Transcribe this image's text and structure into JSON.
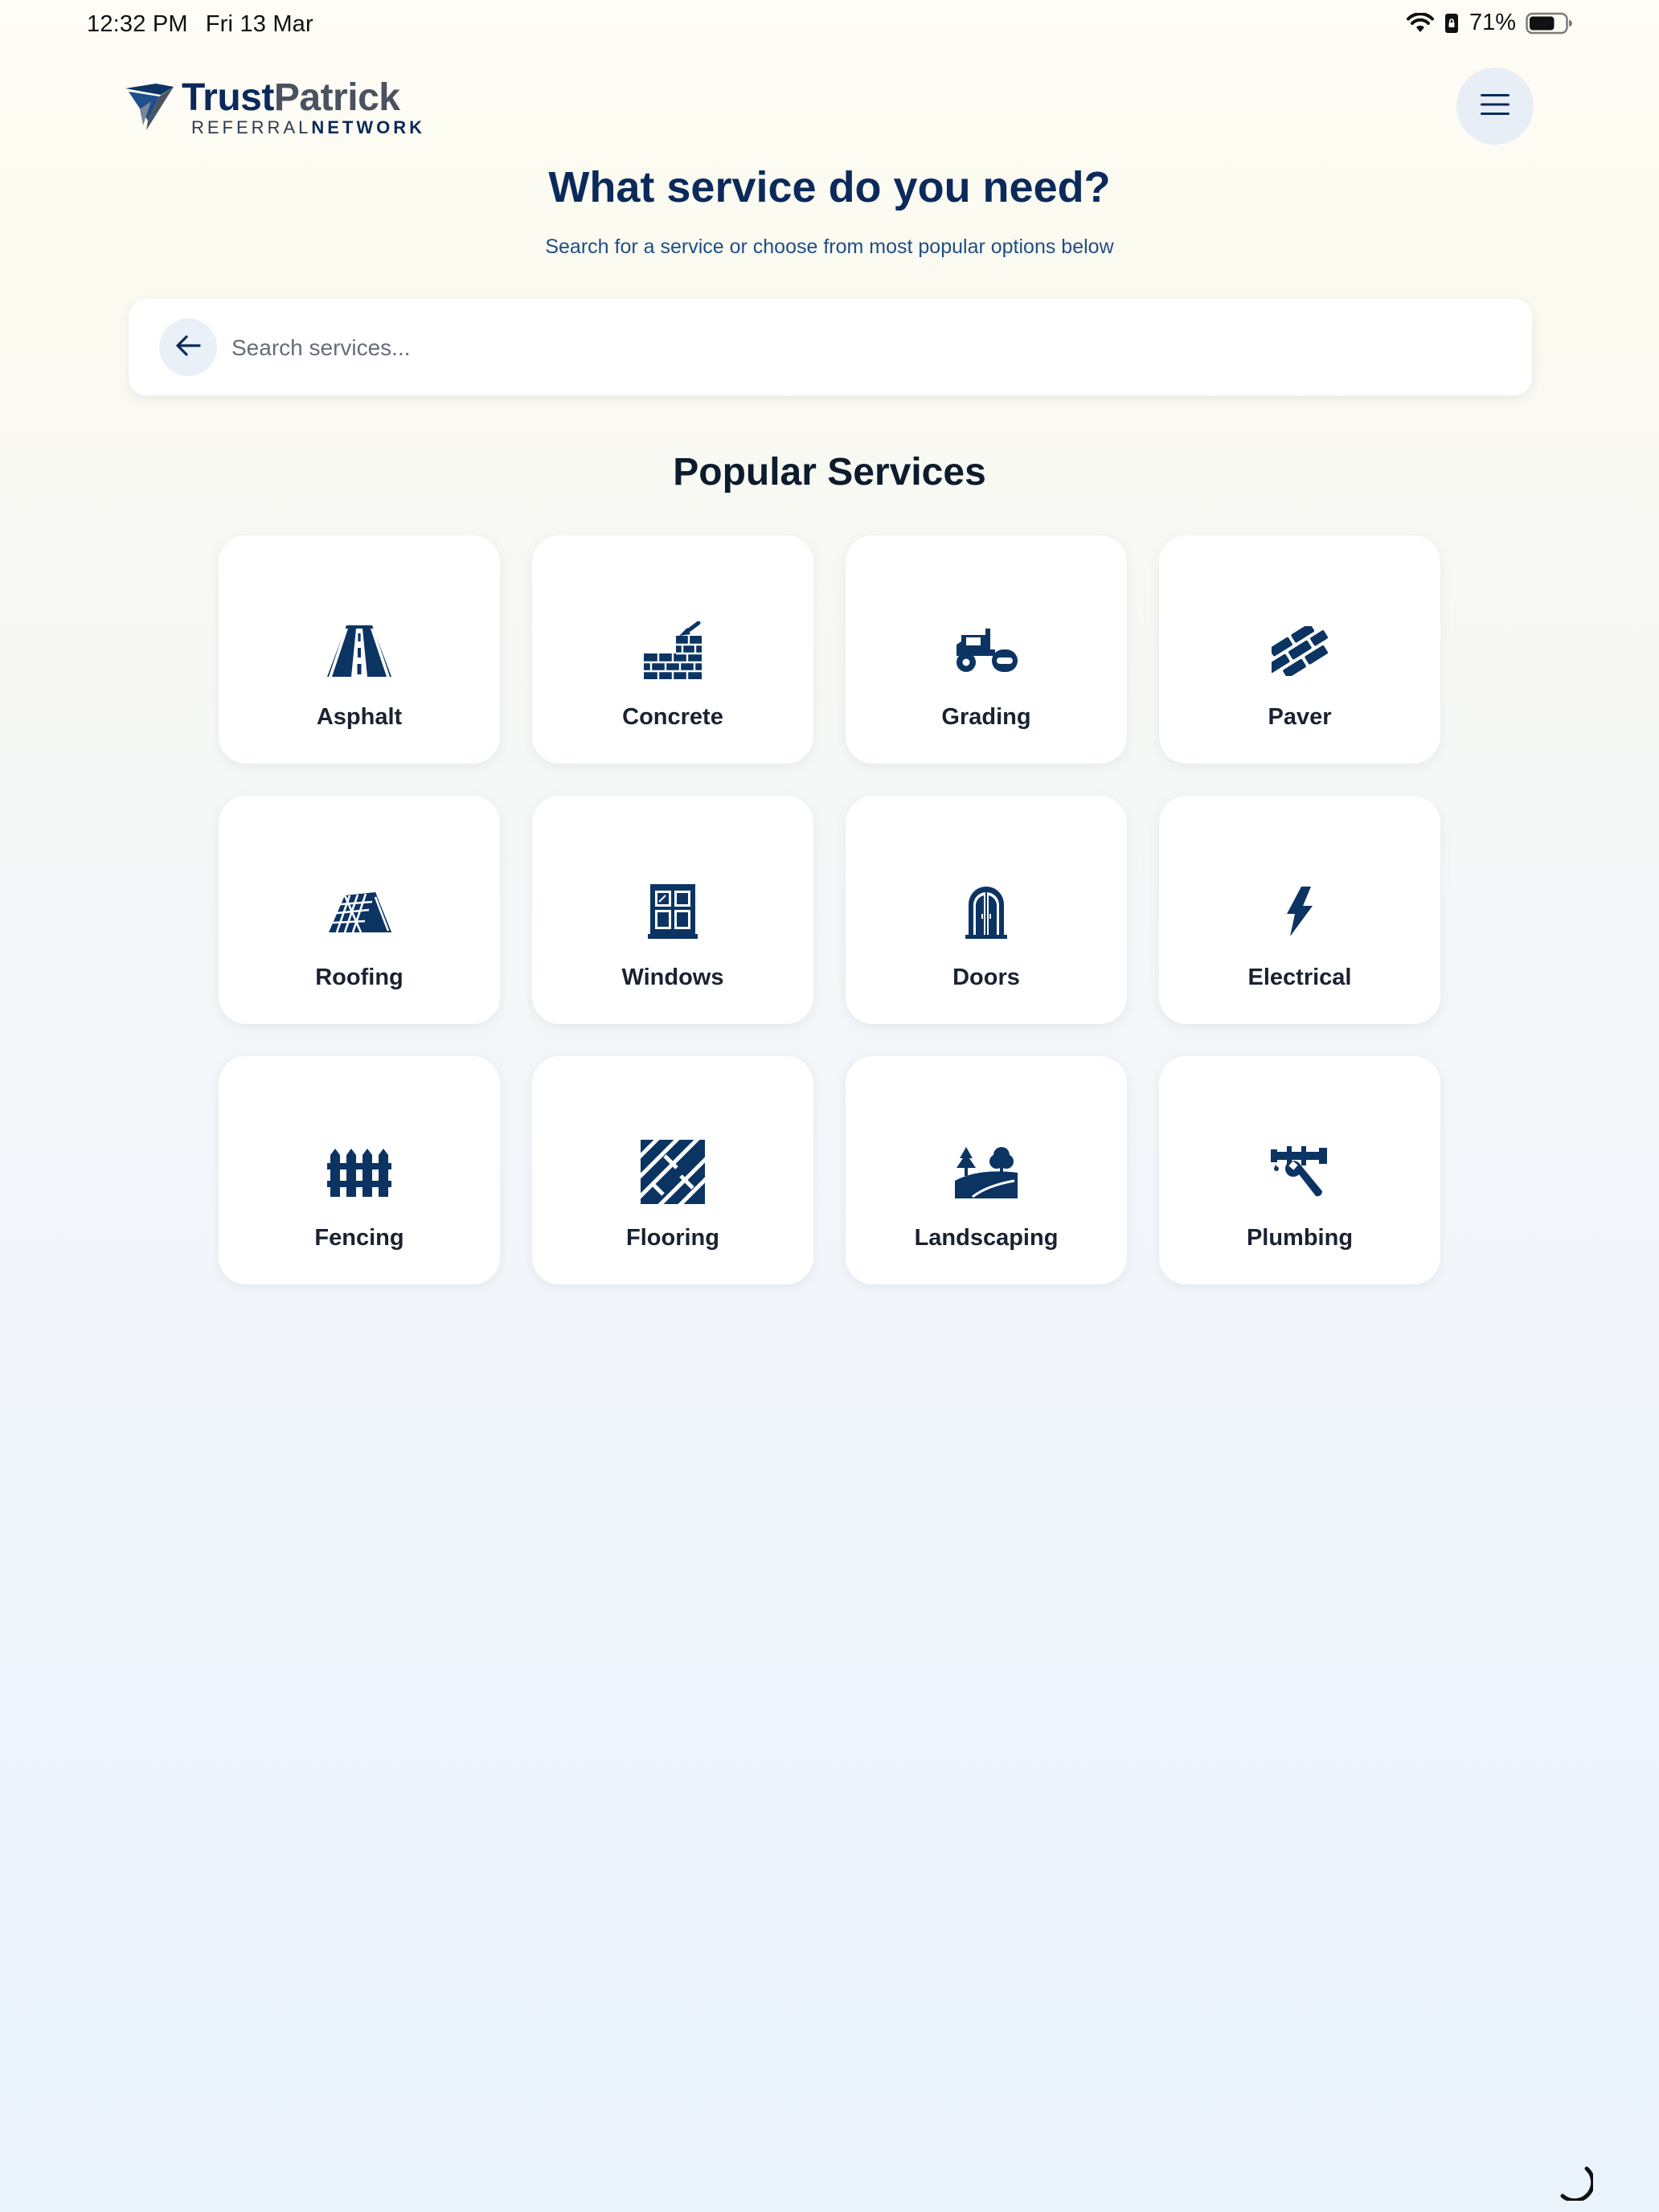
{
  "status_bar": {
    "time": "12:32 PM",
    "date": "Fri 13 Mar",
    "battery": "71%",
    "battery_level": 0.71,
    "icons": [
      "wifi-icon",
      "lock-rotation-icon",
      "battery-icon"
    ]
  },
  "header": {
    "logo_brand_a": "Trust",
    "logo_brand_b": "Patrick",
    "logo_sub_a": "REFERRAL",
    "logo_sub_b": "NETWORK",
    "menu_icon": "hamburger-icon"
  },
  "hero": {
    "title": "What service do you need?",
    "subtitle": "Search for a service or choose from most popular options below"
  },
  "search": {
    "placeholder": "Search services...",
    "value": "",
    "back_icon": "arrow-left-icon"
  },
  "popular": {
    "title": "Popular Services",
    "items": [
      {
        "label": "Asphalt",
        "icon": "road-icon"
      },
      {
        "label": "Concrete",
        "icon": "brick-wall-trowel-icon"
      },
      {
        "label": "Grading",
        "icon": "road-roller-icon"
      },
      {
        "label": "Paver",
        "icon": "paver-bricks-icon"
      },
      {
        "label": "Roofing",
        "icon": "roof-icon"
      },
      {
        "label": "Windows",
        "icon": "window-icon"
      },
      {
        "label": "Doors",
        "icon": "door-icon"
      },
      {
        "label": "Electrical",
        "icon": "lightning-bolt-icon"
      },
      {
        "label": "Fencing",
        "icon": "fence-icon"
      },
      {
        "label": "Flooring",
        "icon": "floor-tiles-icon"
      },
      {
        "label": "Landscaping",
        "icon": "trees-hill-icon"
      },
      {
        "label": "Plumbing",
        "icon": "wrench-pipe-icon"
      }
    ]
  },
  "colors": {
    "brand_navy": "#0b3463",
    "title_navy": "#0b2a5b",
    "card_bg": "#ffffff"
  }
}
